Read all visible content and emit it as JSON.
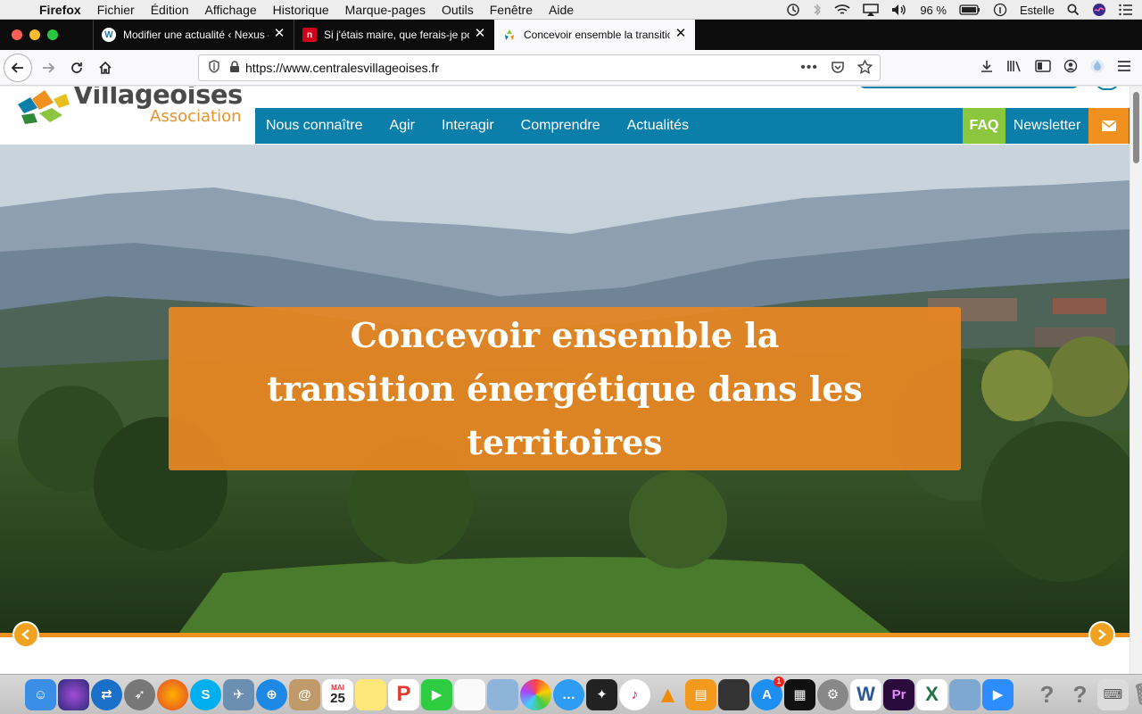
{
  "menubar": {
    "app_name": "Firefox",
    "items": [
      "Fichier",
      "Édition",
      "Affichage",
      "Historique",
      "Marque-pages",
      "Outils",
      "Fenêtre",
      "Aide"
    ],
    "battery": "96 %",
    "user": "Estelle"
  },
  "tabs": [
    {
      "label": "Modifier une actualité ‹ Nexus –",
      "favicon": "wordpress-icon"
    },
    {
      "label": "Si j'étais maire, que ferais-je po",
      "favicon": "n-icon"
    },
    {
      "label": "Concevoir ensemble la transitio",
      "favicon": "site-icon",
      "active": true
    }
  ],
  "url": "https://www.centralesvillageoises.fr",
  "site": {
    "logo_word": "Villageoises",
    "logo_sub": "Association",
    "nav": [
      "Nous connaître",
      "Agir",
      "Interagir",
      "Comprendre",
      "Actualités"
    ],
    "faq": "FAQ",
    "newsletter": "Newsletter",
    "hero_title": "Concevoir ensemble la transition énergétique dans les territoires"
  },
  "dock": {
    "calendar_month": "MAI",
    "calendar_day": "25",
    "appstore_badge": "1"
  },
  "colors": {
    "nav_blue": "#0b7fa9",
    "faq_green": "#8cc63f",
    "orange": "#f0901e"
  }
}
